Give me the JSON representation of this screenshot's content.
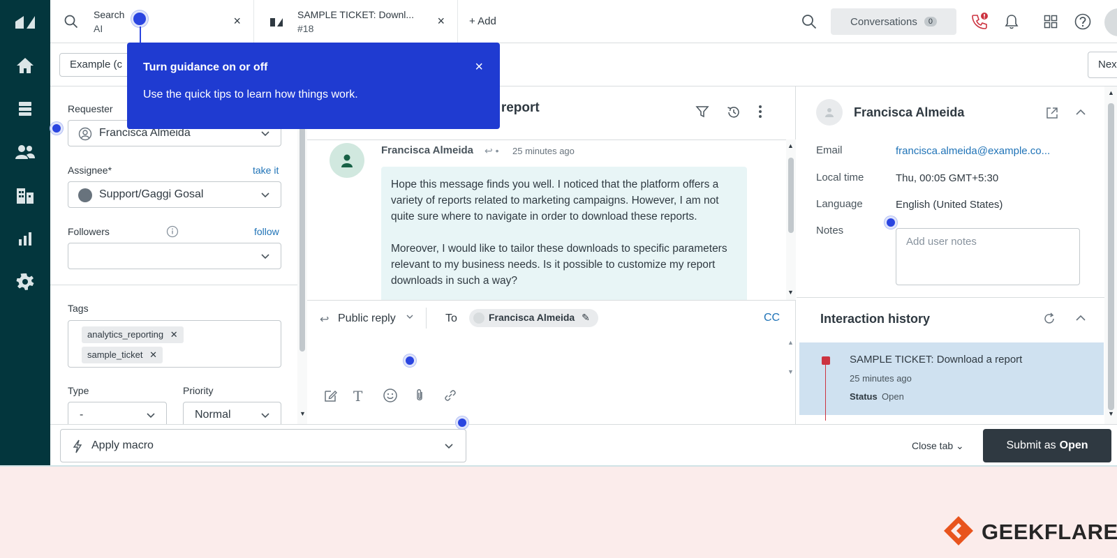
{
  "tabs": [
    {
      "title": "Search",
      "subtitle": "AI",
      "close": "×"
    },
    {
      "title": "SAMPLE TICKET: Downl...",
      "subtitle": "#18",
      "close": "×"
    }
  ],
  "add_tab": "+ Add",
  "conversations": {
    "label": "Conversations",
    "count": "0"
  },
  "view_pill": "Example (c",
  "next_button": "Next",
  "guidance": {
    "title": "Turn guidance on or off",
    "description": "Use the quick tips to learn how things work.",
    "close": "×"
  },
  "properties": {
    "requester_label": "Requester",
    "requester_value": "Francisca Almeida",
    "assignee_label": "Assignee*",
    "take_it": "take it",
    "assignee_value": "Support/Gaggi Gosal",
    "followers_label": "Followers",
    "follow": "follow",
    "tags_label": "Tags",
    "tags": [
      "analytics_reporting",
      "sample_ticket"
    ],
    "type_label": "Type",
    "type_value": "-",
    "priority_label": "Priority",
    "priority_value": "Normal"
  },
  "ticket": {
    "subject_fragment": "a report",
    "author": "Francisca Almeida",
    "time": "25 minutes ago",
    "message_paragraphs": [
      "Hope this message finds you well. I noticed that the platform offers a variety of reports related to marketing campaigns. However, I am not quite sure where to navigate in order to download these reports.",
      "Moreover, I would like to tailor these downloads to specific parameters relevant to my business needs. Is it possible to customize my report downloads in such a way?"
    ]
  },
  "reply": {
    "mode": "Public reply",
    "to_label": "To",
    "to_value": "Francisca Almeida",
    "cc": "CC"
  },
  "user": {
    "name": "Francisca Almeida",
    "email_label": "Email",
    "email": "francisca.almeida@example.co...",
    "local_time_label": "Local time",
    "local_time": "Thu, 00:05 GMT+5:30",
    "language_label": "Language",
    "language": "English (United States)",
    "notes_label": "Notes",
    "notes_placeholder": "Add user notes"
  },
  "interaction_history": {
    "title": "Interaction history",
    "item_title": "SAMPLE TICKET: Download a report",
    "item_time": "25 minutes ago",
    "status_label": "Status",
    "status_value": "Open"
  },
  "bottom": {
    "macro": "Apply macro",
    "close_tab": "Close tab",
    "submit_prefix": "Submit as",
    "submit_status": "Open"
  },
  "footer": {
    "logo_text": "GEEKFLARE"
  },
  "colors": {
    "nav_bg": "#03363d",
    "accent": "#1f3bd1",
    "submit_bg": "#2f3941",
    "link": "#1f73b7",
    "alert_red": "#cc3340"
  }
}
